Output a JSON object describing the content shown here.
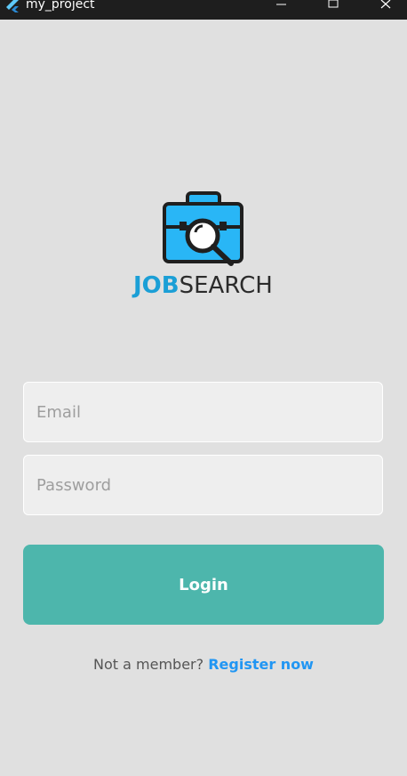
{
  "window": {
    "title": "my_project",
    "app_icon": "flutter-icon"
  },
  "logo": {
    "icon": "briefcase-search-icon",
    "text_part1": "JOB",
    "text_part2": "SEARCH",
    "colors": {
      "job": "#1b9fd6",
      "search": "#2b2b2b",
      "briefcase": "#29b6f6"
    }
  },
  "form": {
    "email_placeholder": "Email",
    "email_value": "",
    "password_placeholder": "Password",
    "password_value": "",
    "login_label": "Login"
  },
  "footer": {
    "prompt": "Not a member?",
    "register_label": "Register now"
  },
  "colors": {
    "background": "#e0e0e0",
    "accent": "#4db6ac",
    "link": "#2196f3"
  }
}
